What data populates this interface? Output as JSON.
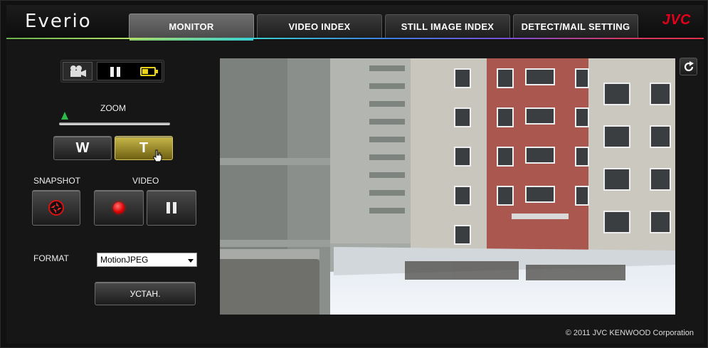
{
  "header": {
    "brand": "Everio",
    "logo": "JVC",
    "tabs": [
      {
        "label": "MONITOR",
        "active": true
      },
      {
        "label": "VIDEO INDEX",
        "active": false
      },
      {
        "label": "STILL IMAGE INDEX",
        "active": false
      },
      {
        "label": "DETECT/MAIL SETTING",
        "active": false
      }
    ]
  },
  "status": {
    "mode_icon": "movie-camera-icon",
    "state_icon": "pause-icon",
    "battery_icon": "battery-icon"
  },
  "zoom": {
    "label": "ZOOM",
    "level": 0.05,
    "wide_label": "W",
    "tele_label": "T"
  },
  "snapshot": {
    "label": "SNAPSHOT",
    "icon": "shutter-icon"
  },
  "video": {
    "label": "VIDEO",
    "record_icon": "record-icon",
    "pause_icon": "pause-icon"
  },
  "format": {
    "label": "FORMAT",
    "selected": "MotionJPEG",
    "apply_label": "УСТАН."
  },
  "viewer": {
    "refresh_icon": "refresh-icon"
  },
  "footer": {
    "copyright": "© 2011 JVC KENWOOD Corporation"
  },
  "colors": {
    "record": "#e00000",
    "tele_button": "#b3a33a",
    "logo": "#e3001b",
    "zoom_thumb": "#2db84a"
  }
}
